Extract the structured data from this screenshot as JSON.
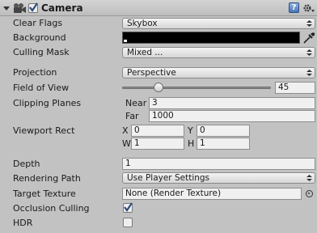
{
  "header": {
    "title": "Camera",
    "enabled": true
  },
  "rows": {
    "clear_flags": {
      "label": "Clear Flags",
      "value": "Skybox"
    },
    "background": {
      "label": "Background",
      "color": "#000000"
    },
    "culling_mask": {
      "label": "Culling Mask",
      "value": "Mixed ..."
    },
    "projection": {
      "label": "Projection",
      "value": "Perspective"
    },
    "field_of_view": {
      "label": "Field of View",
      "value": "45",
      "min": 1,
      "max": 179
    },
    "clipping_planes": {
      "label": "Clipping Planes",
      "near_label": "Near",
      "near": "3",
      "far_label": "Far",
      "far": "1000"
    },
    "viewport_rect": {
      "label": "Viewport Rect",
      "x_label": "X",
      "x": "0",
      "y_label": "Y",
      "y": "0",
      "w_label": "W",
      "w": "1",
      "h_label": "H",
      "h": "1"
    },
    "depth": {
      "label": "Depth",
      "value": "1"
    },
    "rendering_path": {
      "label": "Rendering Path",
      "value": "Use Player Settings"
    },
    "target_texture": {
      "label": "Target Texture",
      "value": "None (Render Texture)"
    },
    "occlusion_culling": {
      "label": "Occlusion Culling",
      "checked": true
    },
    "hdr": {
      "label": "HDR",
      "checked": false
    }
  }
}
